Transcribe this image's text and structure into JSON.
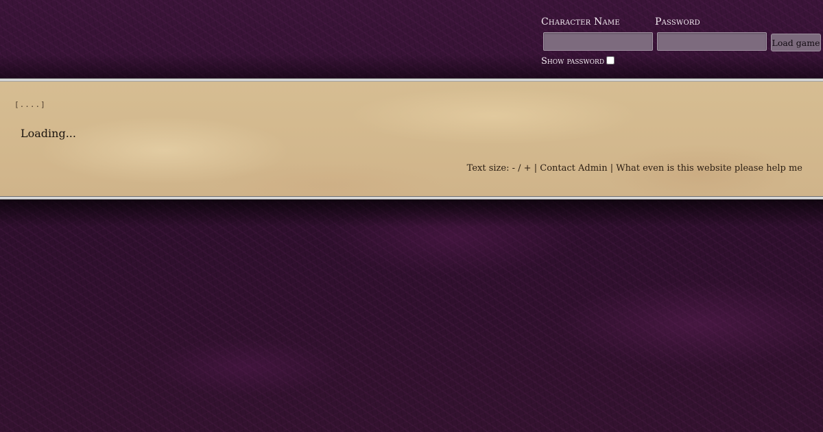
{
  "login": {
    "character_name_label": "Character Name",
    "password_label": "Password",
    "character_name_value": "",
    "password_value": "",
    "load_button": "Load game",
    "show_password_label": "Show password"
  },
  "main": {
    "progress_text": "[....]",
    "status_text": "Loading..."
  },
  "footer": {
    "text_size_label": "Text size:",
    "decrease": "-",
    "separator_slash": "/",
    "increase": "+",
    "separator_1": "|",
    "contact_admin": "Contact Admin",
    "separator_2": "|",
    "help_link": "What even is this website please help me"
  },
  "colors": {
    "background": "#2e0f2d",
    "parchment": "#d4b98e",
    "input_bg": "#7d6b7e"
  }
}
